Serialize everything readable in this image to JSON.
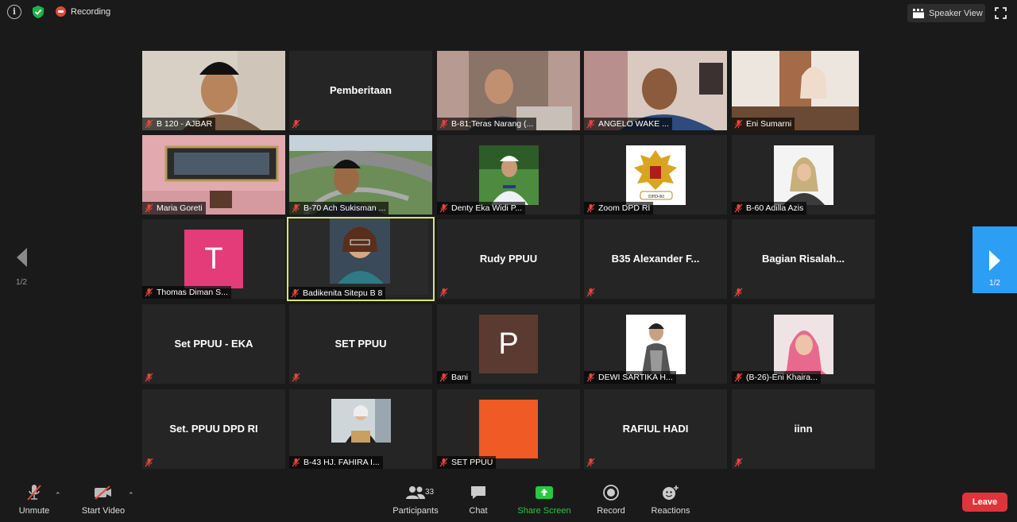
{
  "topbar": {
    "recording_label": "Recording",
    "speaker_view_label": "Speaker View"
  },
  "tiles": [
    {
      "name": "B 120 - AJBAR",
      "kind": "video"
    },
    {
      "name": "Pemberitaan",
      "kind": "name_only"
    },
    {
      "name": "B-81;Teras Narang (...",
      "kind": "video"
    },
    {
      "name": "ANGELO WAKE ...",
      "kind": "video"
    },
    {
      "name": "Eni Sumarni",
      "kind": "video"
    },
    {
      "name": "Maria Goreti",
      "kind": "video"
    },
    {
      "name": "B-70 Ach Sukisman ...",
      "kind": "video"
    },
    {
      "name": "Denty Eka Widi P...",
      "kind": "photo"
    },
    {
      "name": "Zoom DPD RI",
      "kind": "logo",
      "logo_text": "DPD-RI"
    },
    {
      "name": "B-60 Adilla Azis",
      "kind": "photo"
    },
    {
      "name": "Thomas Diman S...",
      "kind": "avatar",
      "initial": "T",
      "color": "#e33c78"
    },
    {
      "name": "Badikenita Sitepu B 8",
      "kind": "video_active"
    },
    {
      "name": "Rudy PPUU",
      "kind": "name_only"
    },
    {
      "name": "B35 Alexander F...",
      "kind": "name_only"
    },
    {
      "name": "Bagian Risalah...",
      "kind": "name_only"
    },
    {
      "name": "Set PPUU - EKA",
      "kind": "name_only"
    },
    {
      "name": "SET PPUU",
      "kind": "name_only"
    },
    {
      "name": "Bani",
      "kind": "avatar",
      "initial": "P",
      "color": "#5b3a32"
    },
    {
      "name": "DEWI SARTIKA H...",
      "kind": "photo"
    },
    {
      "name": "(B-26)-Eni Khaira...",
      "kind": "photo"
    },
    {
      "name": "Set. PPUU DPD RI",
      "kind": "name_only"
    },
    {
      "name": "B-43 HJ. FAHIRA I...",
      "kind": "photo"
    },
    {
      "name": "SET PPUU",
      "kind": "avatar",
      "initial": "",
      "color": "#f05a24"
    },
    {
      "name": "RAFIUL HADI",
      "kind": "name_only"
    },
    {
      "name": "iinn",
      "kind": "name_only"
    }
  ],
  "pagination": {
    "left_page": "1/2",
    "right_page": "1/2"
  },
  "toolbar": {
    "unmute_label": "Unmute",
    "start_video_label": "Start Video",
    "participants_label": "Participants",
    "participants_count": "33",
    "chat_label": "Chat",
    "share_screen_label": "Share Screen",
    "record_label": "Record",
    "reactions_label": "Reactions",
    "leave_label": "Leave"
  },
  "colors": {
    "accent_blue": "#2c9ef4",
    "share_green": "#28c840",
    "leave_red": "#e0343b",
    "active_border": "#d7e67a"
  }
}
